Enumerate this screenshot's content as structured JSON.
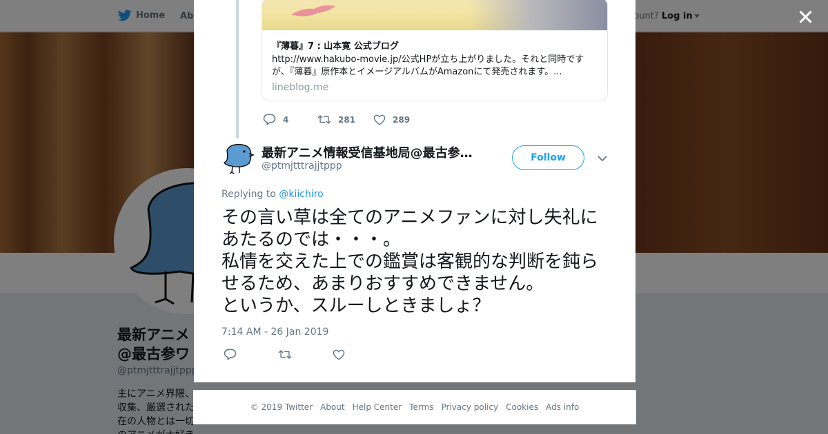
{
  "topbar": {
    "home_label": "Home",
    "about_label": "Abo",
    "account_prompt": "ccount?",
    "login_label": "Log in"
  },
  "profile": {
    "name_line1": "最新アニメ",
    "name_line2": "@最古参ワ",
    "handle": "@ptmjtttrajjtppp",
    "bio": [
      "主にアニメ界隈、",
      "収集、厳選された",
      "在の人物とは一切",
      "のアニメが大好き"
    ]
  },
  "parent_tweet": {
    "card": {
      "title": "『薄暮』7 : 山本寛 公式ブログ",
      "description": "http://www.hakubo-movie.jp/公式HPが立ち上がりました。それと同時ですが、『薄暮』原作本とイメージアルバムがAmazonにて発売されます。...",
      "domain": "lineblog.me"
    },
    "reply_count": "4",
    "retweet_count": "281",
    "like_count": "289"
  },
  "tweet": {
    "author_name": "最新アニメ情報受信基地局@最古参…",
    "author_handle": "@ptmjtttrajjtppp",
    "follow_label": "Follow",
    "replying_prefix": "Replying to",
    "replying_to": "@kiichiro",
    "text": "その言い草は全てのアニメファンに対し失礼にあたるのでは・・・。\n私情を交えた上での鑑賞は客観的な判断を鈍らせるため、あまりおすすめできません。\nというか、スルーしときましょ？",
    "timestamp": "7:14 AM - 26 Jan 2019"
  },
  "footer": {
    "copyright": "© 2019 Twitter",
    "about": "About",
    "help": "Help Center",
    "terms": "Terms",
    "privacy": "Privacy policy",
    "cookies": "Cookies",
    "ads": "Ads info"
  },
  "colors": {
    "brand": "#1da1f2",
    "link": "#1b95e0",
    "text": "#14171a",
    "muted": "#657786"
  },
  "icons": [
    "twitter-bird-icon",
    "close-icon",
    "reply-icon",
    "retweet-icon",
    "like-icon",
    "chevron-down-icon"
  ]
}
